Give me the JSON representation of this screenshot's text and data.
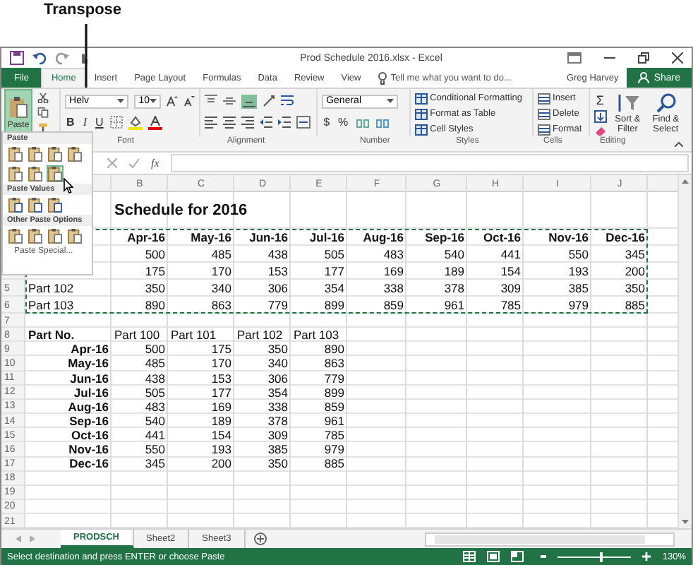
{
  "callout": {
    "label": "Transpose"
  },
  "title_bar": {
    "title": "Prod Schedule 2016.xlsx - Excel"
  },
  "ribbon_tabs": [
    {
      "label": "File",
      "kind": "file",
      "selected": false
    },
    {
      "label": "Home",
      "kind": "tab",
      "selected": true
    },
    {
      "label": "Insert",
      "kind": "tab",
      "selected": false
    },
    {
      "label": "Page Layout",
      "kind": "tab",
      "selected": false
    },
    {
      "label": "Formulas",
      "kind": "tab",
      "selected": false
    },
    {
      "label": "Data",
      "kind": "tab",
      "selected": false
    },
    {
      "label": "Review",
      "kind": "tab",
      "selected": false
    },
    {
      "label": "View",
      "kind": "tab",
      "selected": false
    }
  ],
  "tell_me": {
    "placeholder": "Tell me what you want to do..."
  },
  "user": "Greg Harvey",
  "share_button": "Share",
  "ribbon": {
    "paste_button": "Paste",
    "font_name": "Helv",
    "font_size": "10",
    "bold": "B",
    "italic": "I",
    "underline": "U",
    "number_format": "General",
    "currency": "$",
    "percent": "%",
    "styles": [
      "Conditional Formatting",
      "Format as Table",
      "Cell Styles"
    ],
    "cells": [
      "Insert",
      "Delete",
      "Format"
    ],
    "autosum": "Σ",
    "editing": [
      "Sort & Filter",
      "Find & Select"
    ],
    "group_labels": [
      "Font",
      "Alignment",
      "Number",
      "Styles",
      "Cells",
      "Editing"
    ]
  },
  "paste_menu": {
    "sections": [
      {
        "heading": "Paste",
        "options": [
          {
            "selected": false
          },
          {
            "selected": false
          },
          {
            "selected": false
          },
          {
            "selected": false
          },
          {
            "selected": false
          },
          {
            "selected": false
          },
          {
            "selected": true
          }
        ]
      },
      {
        "heading": "Paste Values",
        "options": [
          {
            "selected": false
          },
          {
            "selected": false
          },
          {
            "selected": false
          }
        ]
      },
      {
        "heading": "Other Paste Options",
        "options": [
          {
            "selected": false
          },
          {
            "selected": false
          },
          {
            "selected": false
          },
          {
            "selected": false
          }
        ]
      }
    ],
    "special": "Paste Special..."
  },
  "formula_bar": {
    "function_label": "fx"
  },
  "sheet": {
    "columns": [
      "B",
      "C",
      "D",
      "E",
      "F",
      "G",
      "H",
      "I",
      "J"
    ],
    "rows": [
      {
        "kind": "title",
        "copied": false,
        "title": "Schedule for 2016"
      },
      {
        "kind": "months",
        "copied": true,
        "values": [
          "Apr-16",
          "May-16",
          "Jun-16",
          "Jul-16",
          "Aug-16",
          "Sep-16",
          "Oct-16",
          "Nov-16",
          "Dec-16"
        ]
      },
      {
        "kind": "data",
        "copied": true,
        "values": [
          "500",
          "485",
          "438",
          "505",
          "483",
          "540",
          "441",
          "550",
          "345"
        ]
      },
      {
        "kind": "data",
        "copied": true,
        "values": [
          "175",
          "170",
          "153",
          "177",
          "169",
          "189",
          "154",
          "193",
          "200"
        ]
      },
      {
        "kind": "data",
        "number": "5",
        "copied": true,
        "label": "Part 102",
        "values": [
          "350",
          "340",
          "306",
          "354",
          "338",
          "378",
          "309",
          "385",
          "350"
        ]
      },
      {
        "kind": "data",
        "number": "6",
        "copied": true,
        "label": "Part 103",
        "values": [
          "890",
          "863",
          "779",
          "899",
          "859",
          "961",
          "785",
          "979",
          "885"
        ]
      },
      {
        "kind": "blank",
        "number": "7",
        "copied": false
      },
      {
        "kind": "parts",
        "number": "8",
        "copied": false,
        "label": "Part No.",
        "values": [
          "Part 100",
          "Part 101",
          "Part 102",
          "Part 103"
        ]
      },
      {
        "kind": "transposed",
        "number": "9",
        "copied": false,
        "label": "Apr-16",
        "values": [
          "500",
          "175",
          "350",
          "890"
        ]
      },
      {
        "kind": "transposed",
        "number": "10",
        "copied": false,
        "label": "May-16",
        "values": [
          "485",
          "170",
          "340",
          "863"
        ]
      },
      {
        "kind": "transposed",
        "number": "11",
        "copied": false,
        "label": "Jun-16",
        "values": [
          "438",
          "153",
          "306",
          "779"
        ]
      },
      {
        "kind": "transposed",
        "number": "12",
        "copied": false,
        "label": "Jul-16",
        "values": [
          "505",
          "177",
          "354",
          "899"
        ]
      },
      {
        "kind": "transposed",
        "number": "13",
        "copied": false,
        "label": "Aug-16",
        "values": [
          "483",
          "169",
          "338",
          "859"
        ]
      },
      {
        "kind": "transposed",
        "number": "14",
        "copied": false,
        "label": "Sep-16",
        "values": [
          "540",
          "189",
          "378",
          "961"
        ]
      },
      {
        "kind": "transposed",
        "number": "15",
        "copied": false,
        "label": "Oct-16",
        "values": [
          "441",
          "154",
          "309",
          "785"
        ]
      },
      {
        "kind": "transposed",
        "number": "16",
        "copied": false,
        "label": "Nov-16",
        "values": [
          "550",
          "193",
          "385",
          "979"
        ]
      },
      {
        "kind": "transposed",
        "number": "17",
        "copied": false,
        "label": "Dec-16",
        "values": [
          "345",
          "200",
          "350",
          "885"
        ]
      },
      {
        "kind": "blank",
        "number": "18",
        "copied": false
      },
      {
        "kind": "blank",
        "number": "19",
        "copied": false
      },
      {
        "kind": "blank",
        "number": "20",
        "copied": false
      },
      {
        "kind": "blank",
        "number": "21",
        "copied": false
      }
    ]
  },
  "sheet_tabs": [
    {
      "label": "PRODSCH",
      "selected": true
    },
    {
      "label": "Sheet2",
      "selected": false
    },
    {
      "label": "Sheet3",
      "selected": false
    }
  ],
  "status_bar": {
    "message": "Select destination and press ENTER or choose Paste",
    "zoom_slider": {
      "level": 0.57
    },
    "zoom": "130%"
  }
}
